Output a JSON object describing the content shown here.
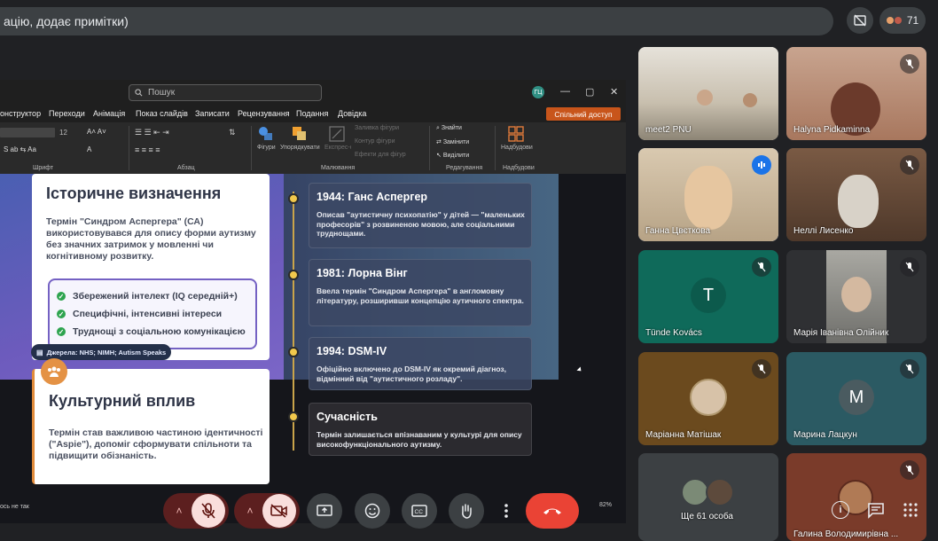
{
  "meet": {
    "topbar_text": "ацію, додає примітки)",
    "participant_count": "71",
    "bottom_bar": {
      "mic": "mic-off",
      "camera": "camera-off",
      "present": "present-screen",
      "emoji": "emoji",
      "captions": "captions",
      "raise_hand": "raise-hand",
      "more": "more-options",
      "hangup": "leave-call"
    },
    "tiles": [
      {
        "name": "meet2 PNU",
        "muted": false,
        "color": "#c9c2b4"
      },
      {
        "name": "Halyna Pidkaminna",
        "muted": true,
        "color": "#b98c73"
      },
      {
        "name": "Ганна Цвєткова",
        "muted": false,
        "speaking": true,
        "color": "#d7c8b0"
      },
      {
        "name": "Неллі Лисенко",
        "muted": true,
        "color": "#6f5240"
      },
      {
        "name": "Tünde Kovács",
        "muted": true,
        "initial": "T",
        "color": "#0f6a5a"
      },
      {
        "name": "Марія Іванівна Олійник",
        "muted": true,
        "color": "#8b8b86"
      },
      {
        "name": "Маріанна Матішак",
        "muted": true,
        "color": "#6b4a1e"
      },
      {
        "name": "Марина Лацкун",
        "muted": true,
        "initial": "M",
        "color": "#2b5a63"
      },
      {
        "name": "Ще 61 особа",
        "muted": false,
        "color": "#3c4043"
      },
      {
        "name": "Галина Володимирівна ...",
        "muted": true,
        "color": "#7a3b2a"
      }
    ]
  },
  "ppt": {
    "search_placeholder": "Пошук",
    "user_initials": "ГЦ",
    "menu": [
      "онструктор",
      "Переходи",
      "Анімація",
      "Показ слайдів",
      "Записати",
      "Рецензування",
      "Подання",
      "Довідка"
    ],
    "share_button": "Спільний доступ",
    "ribbon": {
      "font_size": "12",
      "font_group": "Шрифт",
      "paragraph_group": "Абзац",
      "shapes": "Фігури",
      "arrange": "Упорядкувати",
      "quick_styles": "Експрес-стилі",
      "shape_fill": "Заливка фігури",
      "shape_outline": "Контур фігури",
      "shape_effects": "Ефекти для фігур",
      "drawing_group": "Малювання",
      "find": "Знайти",
      "replace": "Замінити",
      "select": "Виділити",
      "editing_group": "Редагування",
      "addins": "Надбудови",
      "addins_group": "Надбудови"
    },
    "status_left": "ось не так",
    "zoom": "82%"
  },
  "slide": {
    "history": {
      "title": "Історичне визначення",
      "text": "Термін \"Синдром Аспергера\" (СА) використовувався для опису форми аутизму без значних затримок у мовленні чи когнітивному розвитку.",
      "bullets": [
        "Збережений інтелект (IQ середній+)",
        "Специфічні, інтенсивні інтереси",
        "Труднощі з соціальною комунікацією"
      ],
      "sources": "Джерела: NHS; NIMH; Autism Speaks"
    },
    "culture": {
      "title": "Культурний вплив",
      "text": "Термін став важливою частиною ідентичності (\"Aspie\"), допоміг сформувати спільноти та підвищити обізнаність."
    },
    "timeline": [
      {
        "title": "1944: Ганс Аспергер",
        "text": "Описав \"аутистичну психопатію\" у дітей — \"маленьких професорів\" з розвиненою мовою, але соціальними труднощами."
      },
      {
        "title": "1981: Лорна Вінг",
        "text": "Ввела термін \"Синдром Аспергера\" в англомовну літературу, розширивши концепцію аутичного спектра."
      },
      {
        "title": "1994: DSM-IV",
        "text": "Офіційно включено до DSM-IV як окремий діагноз, відмінний від \"аутистичного розладу\"."
      },
      {
        "title": "Сучасність",
        "text": "Термін залишається впізнаваним у культурі для опису високофункціонального аутизму."
      }
    ]
  }
}
